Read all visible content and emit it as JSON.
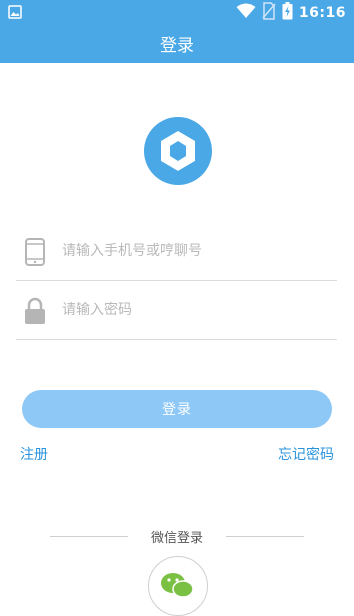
{
  "status_bar": {
    "time": "16:16",
    "icons": [
      "image-notification-icon",
      "wifi-icon",
      "no-sim-icon",
      "battery-charging-icon"
    ]
  },
  "header": {
    "title": "登录"
  },
  "form": {
    "phone_placeholder": "请输入手机号或哼聊号",
    "password_placeholder": "请输入密码",
    "login_label": "登录"
  },
  "links": {
    "register": "注册",
    "forgot_password": "忘记密码"
  },
  "wechat": {
    "label": "微信登录"
  },
  "colors": {
    "primary": "#4aa8e6",
    "button": "#8ec8f7",
    "link": "#2a93dd",
    "wechat_green": "#7ac143"
  }
}
